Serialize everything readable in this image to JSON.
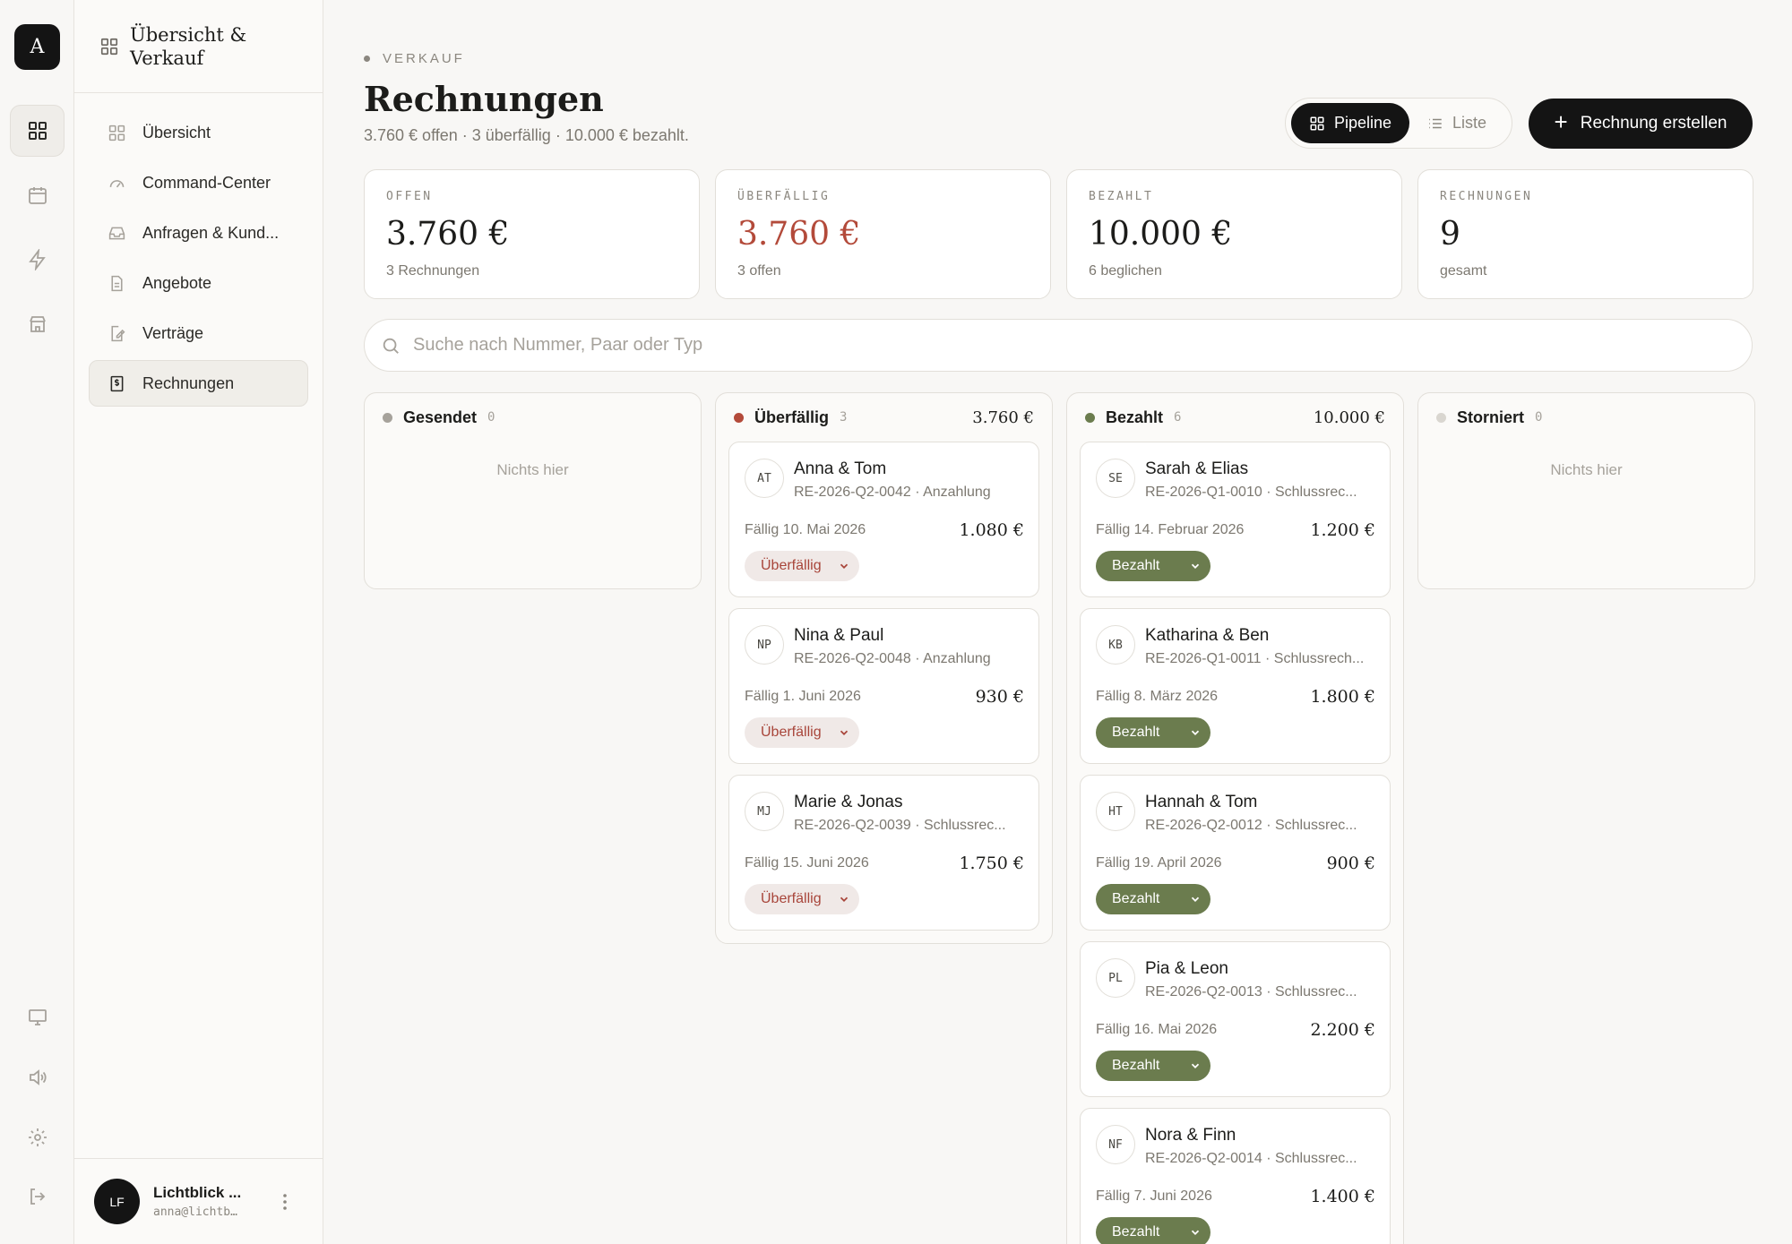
{
  "rail": {
    "logo_letter": "A",
    "icons": [
      "grid-icon",
      "calendar-icon",
      "bolt-icon",
      "store-icon",
      "monitor-icon",
      "speaker-icon",
      "gear-icon",
      "logout-icon"
    ]
  },
  "sidebar": {
    "title": "Übersicht & Verkauf",
    "items": [
      {
        "label": "Übersicht",
        "icon": "grid-icon"
      },
      {
        "label": "Command-Center",
        "icon": "gauge-icon"
      },
      {
        "label": "Anfragen & Kund...",
        "icon": "inbox-icon"
      },
      {
        "label": "Angebote",
        "icon": "document-icon"
      },
      {
        "label": "Verträge",
        "icon": "signed-document-icon"
      },
      {
        "label": "Rechnungen",
        "icon": "invoice-icon",
        "active": true
      }
    ],
    "account": {
      "initials": "LF",
      "name": "Lichtblick ...",
      "email": "anna@lichtb…"
    }
  },
  "header": {
    "eyebrow": "VERKAUF",
    "title": "Rechnungen",
    "subtitle": "3.760 € offen · 3 überfällig · 10.000 € bezahlt.",
    "view_toggle": {
      "pipeline": "Pipeline",
      "list": "Liste",
      "selected": "Pipeline"
    },
    "create_label": "Rechnung erstellen"
  },
  "stats": [
    {
      "label": "OFFEN",
      "value": "3.760 €",
      "sub": "3 Rechnungen"
    },
    {
      "label": "ÜBERFÄLLIG",
      "value": "3.760 €",
      "sub": "3 offen"
    },
    {
      "label": "BEZAHLT",
      "value": "10.000 €",
      "sub": "6 beglichen"
    },
    {
      "label": "RECHNUNGEN",
      "value": "9",
      "sub": "gesamt"
    }
  ],
  "search": {
    "placeholder": "Suche nach Nummer, Paar oder Typ",
    "value": ""
  },
  "colors": {
    "overdue": "#b34a3a",
    "paid": "#6b7c4e",
    "sent": "#a6a29b",
    "cancelled": "#d9d6d0"
  },
  "board": {
    "empty_text": "Nichts hier",
    "columns": [
      {
        "title": "Gesendet",
        "count": "0",
        "total": "",
        "cards": []
      },
      {
        "title": "Überfällig",
        "count": "3",
        "total": "3.760 €",
        "cards": [
          {
            "initials": "AT",
            "name": "Anna & Tom",
            "ref": "RE-2026-Q2-0042 · Anzahlung",
            "due": "Fällig 10. Mai 2026",
            "amount": "1.080 €",
            "status": "Überfällig"
          },
          {
            "initials": "NP",
            "name": "Nina & Paul",
            "ref": "RE-2026-Q2-0048 · Anzahlung",
            "due": "Fällig 1. Juni 2026",
            "amount": "930 €",
            "status": "Überfällig"
          },
          {
            "initials": "MJ",
            "name": "Marie & Jonas",
            "ref": "RE-2026-Q2-0039 · Schlussrec...",
            "due": "Fällig 15. Juni 2026",
            "amount": "1.750 €",
            "status": "Überfällig"
          }
        ]
      },
      {
        "title": "Bezahlt",
        "count": "6",
        "total": "10.000 €",
        "cards": [
          {
            "initials": "SE",
            "name": "Sarah & Elias",
            "ref": "RE-2026-Q1-0010 · Schlussrec...",
            "due": "Fällig 14. Februar 2026",
            "amount": "1.200 €",
            "status": "Bezahlt"
          },
          {
            "initials": "KB",
            "name": "Katharina & Ben",
            "ref": "RE-2026-Q1-0011 · Schlussrech...",
            "due": "Fällig 8. März 2026",
            "amount": "1.800 €",
            "status": "Bezahlt"
          },
          {
            "initials": "HT",
            "name": "Hannah & Tom",
            "ref": "RE-2026-Q2-0012 · Schlussrec...",
            "due": "Fällig 19. April 2026",
            "amount": "900 €",
            "status": "Bezahlt"
          },
          {
            "initials": "PL",
            "name": "Pia & Leon",
            "ref": "RE-2026-Q2-0013 · Schlussrec...",
            "due": "Fällig 16. Mai 2026",
            "amount": "2.200 €",
            "status": "Bezahlt"
          },
          {
            "initials": "NF",
            "name": "Nora & Finn",
            "ref": "RE-2026-Q2-0014 · Schlussrec...",
            "due": "Fällig 7. Juni 2026",
            "amount": "1.400 €",
            "status": "Bezahlt"
          }
        ]
      },
      {
        "title": "Storniert",
        "count": "0",
        "total": "",
        "cards": []
      }
    ]
  }
}
